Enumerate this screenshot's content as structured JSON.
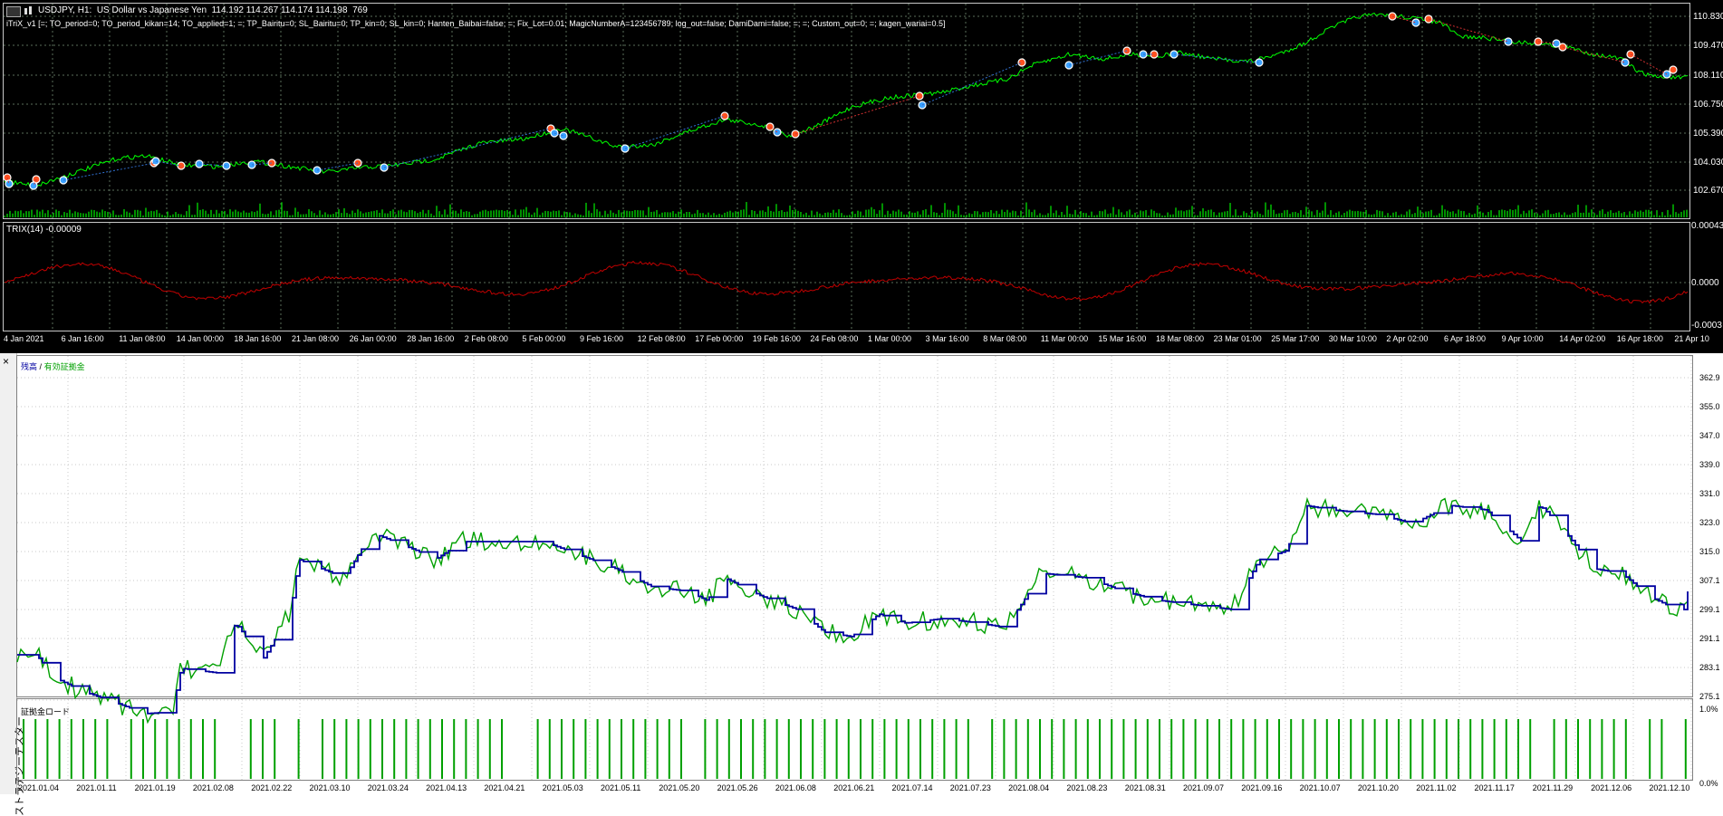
{
  "price_chart": {
    "header": "USDJPY, H1:  US Dollar vs Japanese Yen  114.192 114.267 114.174 114.198  769",
    "indicator_params": "iTriX_v1 [=; TO_period=0; TO_period_kikan=14; TO_applied=1; =; TP_Bairitu=0; SL_Bairitu=0; TP_kin=0; SL_kin=0; Hanten_Baibai=false; =; Fix_Lot=0.01; MagicNumberA=123456789; log_out=false; DamiDami=false; =; =; Custom_out=0; =; kagen_wariai=0.5]",
    "price_axis": [
      "110.830",
      "109.470",
      "108.110",
      "106.750",
      "105.390",
      "104.030",
      "102.670"
    ],
    "trix_label": "TRIX(14) -0.00009",
    "trix_axis": [
      "0.00043",
      "0.0000",
      "-0.0003"
    ],
    "time_axis": [
      "4 Jan 2021",
      "6 Jan 16:00",
      "11 Jan 08:00",
      "14 Jan 00:00",
      "18 Jan 16:00",
      "21 Jan 08:00",
      "26 Jan 00:00",
      "28 Jan 16:00",
      "2 Feb 08:00",
      "5 Feb 00:00",
      "9 Feb 16:00",
      "12 Feb 08:00",
      "17 Feb 00:00",
      "19 Feb 16:00",
      "24 Feb 08:00",
      "1 Mar 00:00",
      "3 Mar 16:00",
      "8 Mar 08:00",
      "11 Mar 00:00",
      "15 Mar 16:00",
      "18 Mar 08:00",
      "23 Mar 01:00",
      "25 Mar 17:00",
      "30 Mar 10:00",
      "2 Apr 02:00",
      "6 Apr 18:00",
      "9 Apr 10:00",
      "14 Apr 02:00",
      "16 Apr 18:00",
      "21 Apr 10"
    ],
    "colors": {
      "price_line": "#00ff00",
      "trix_line": "#c00000",
      "volume": "#00c000",
      "buy": "#3aa0ff",
      "sell": "#ff5020",
      "grid": "#5a6e5a"
    }
  },
  "tester": {
    "close_icon": "×",
    "legend_balance": "残高",
    "legend_sep": "/",
    "legend_equity": "有効証拠金",
    "equity_axis": [
      "362.9",
      "355.0",
      "347.0",
      "339.0",
      "331.0",
      "323.0",
      "315.0",
      "307.1",
      "299.1",
      "291.1",
      "283.1",
      "275.1"
    ],
    "margin_label": "証拠金ロード",
    "margin_axis": [
      "1.0%",
      "0.0%"
    ],
    "vertical_tab": "ストラテジーテスター",
    "date_axis": [
      "2021.01.04",
      "2021.01.11",
      "2021.01.19",
      "2021.02.08",
      "2021.02.22",
      "2021.03.10",
      "2021.03.24",
      "2021.04.13",
      "2021.04.21",
      "2021.05.03",
      "2021.05.11",
      "2021.05.20",
      "2021.05.26",
      "2021.06.08",
      "2021.06.21",
      "2021.07.14",
      "2021.07.23",
      "2021.08.04",
      "2021.08.23",
      "2021.08.31",
      "2021.09.07",
      "2021.09.16",
      "2021.10.07",
      "2021.10.20",
      "2021.11.02",
      "2021.11.17",
      "2021.11.29",
      "2021.12.06",
      "2021.12.10"
    ],
    "colors": {
      "balance": "#0000a0",
      "equity": "#00a000",
      "margin": "#00a000",
      "grid": "#c8c8c8"
    }
  }
}
